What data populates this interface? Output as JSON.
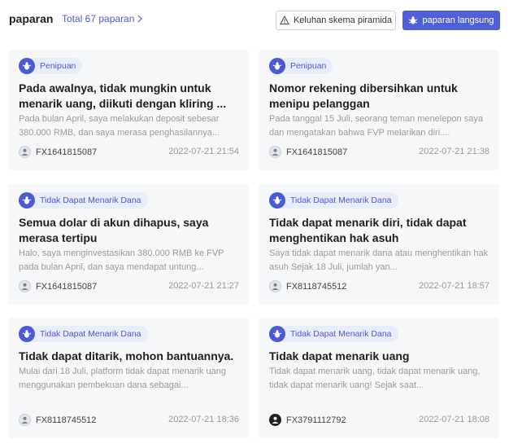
{
  "header": {
    "title": "paparan",
    "total": "Total 67 paparan",
    "warn_button": "Keluhan skema piramida",
    "primary_button": "paparan langsung"
  },
  "colors": {
    "accent": "#4f5fd7",
    "tag_bg": "#e9ecfb",
    "card_bg": "#f6f7f9"
  },
  "cards": [
    {
      "tag": "Penipuan",
      "title": "Pada awalnya, tidak mungkin untuk menarik uang, diikuti dengan kliring ...",
      "desc": "Pada bulan April, saya melakukan deposit sebesar 380.000 RMB, dan saya merasa penghasilannya...",
      "user": "FX1641815087",
      "date": "2022-07-21 21:54"
    },
    {
      "tag": "Penipuan",
      "title": "Nomor rekening dibersihkan untuk menipu pelanggan",
      "desc": "Pada tanggal 15 Juli, seorang teman menelepon saya dan mengatakan bahwa FVP melarikan diri....",
      "user": "FX1641815087",
      "date": "2022-07-21 21:38"
    },
    {
      "tag": "Tidak Dapat Menarik Dana",
      "title": "Semua dolar di akun dihapus, saya merasa tertipu",
      "desc": "Halo, saya menginvestasikan 380.000 RMB ke FVP pada bulan April, dan saya mendapat untung...",
      "user": "FX1641815087",
      "date": "2022-07-21 21:27"
    },
    {
      "tag": "Tidak Dapat Menarik Dana",
      "title": "Tidak dapat menarik diri, tidak dapat menghentikan hak asuh",
      "desc": "Saya tidak dapat menarik dana atau menghentikan hak asuh Sejak 18 Juli, jumlah yan...",
      "user": "FX8118745512",
      "date": "2022-07-21 18:57"
    },
    {
      "tag": "Tidak Dapat Menarik Dana",
      "title": "Tidak dapat ditarik, mohon bantuannya.",
      "desc": "Mulai dari 18 Juli, platform tidak dapat menarik uang menggunakan pembekuan dana sebagai...",
      "user": "FX8118745512",
      "date": "2022-07-21 18:36"
    },
    {
      "tag": "Tidak Dapat Menarik Dana",
      "title": "Tidak dapat menarik uang",
      "desc": "Tidak dapat menarik uang, tidak dapat menarik uang, tidak dapat menarik uang! Sejak saat...",
      "user": "FX3791112792",
      "date": "2022-07-21 18:08"
    }
  ]
}
